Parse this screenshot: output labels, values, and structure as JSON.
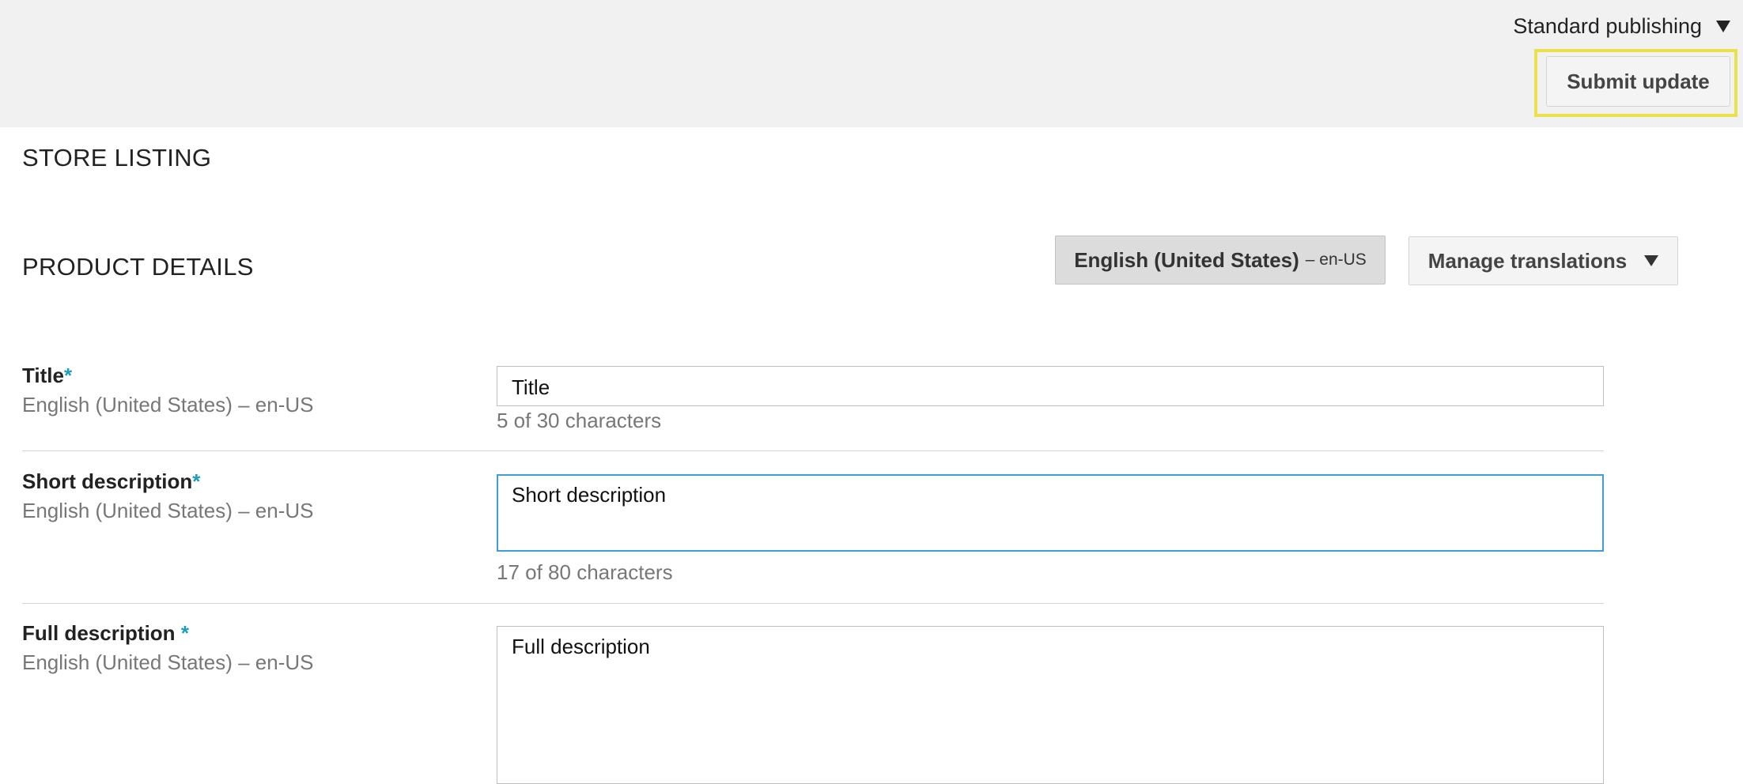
{
  "topbar": {
    "publishing_label": "Standard publishing",
    "submit_label": "Submit update"
  },
  "store_listing": {
    "heading": "STORE LISTING"
  },
  "product_details": {
    "heading": "PRODUCT DETAILS",
    "language_button": {
      "name": "English (United States)",
      "code": "– en-US"
    },
    "manage_translations_label": "Manage translations"
  },
  "fields": [
    {
      "label": "Title",
      "required_mark": "*",
      "language": "English (United States) – en-US",
      "value": "Title",
      "counter": "5 of 30 characters"
    },
    {
      "label": "Short description",
      "required_mark": "*",
      "language": "English (United States) – en-US",
      "value": "Short description",
      "counter": "17 of 80 characters"
    },
    {
      "label": "Full description",
      "required_mark": "*",
      "language": "English (United States) – en-US",
      "value": "Full description"
    }
  ],
  "colors": {
    "required_mark": "#1a9fb6",
    "focus_border": "#3d9fd6",
    "highlight": "#eae04a",
    "topbar_bg": "#f1f1f1"
  },
  "icons": [
    "dropdown-caret-icon"
  ]
}
